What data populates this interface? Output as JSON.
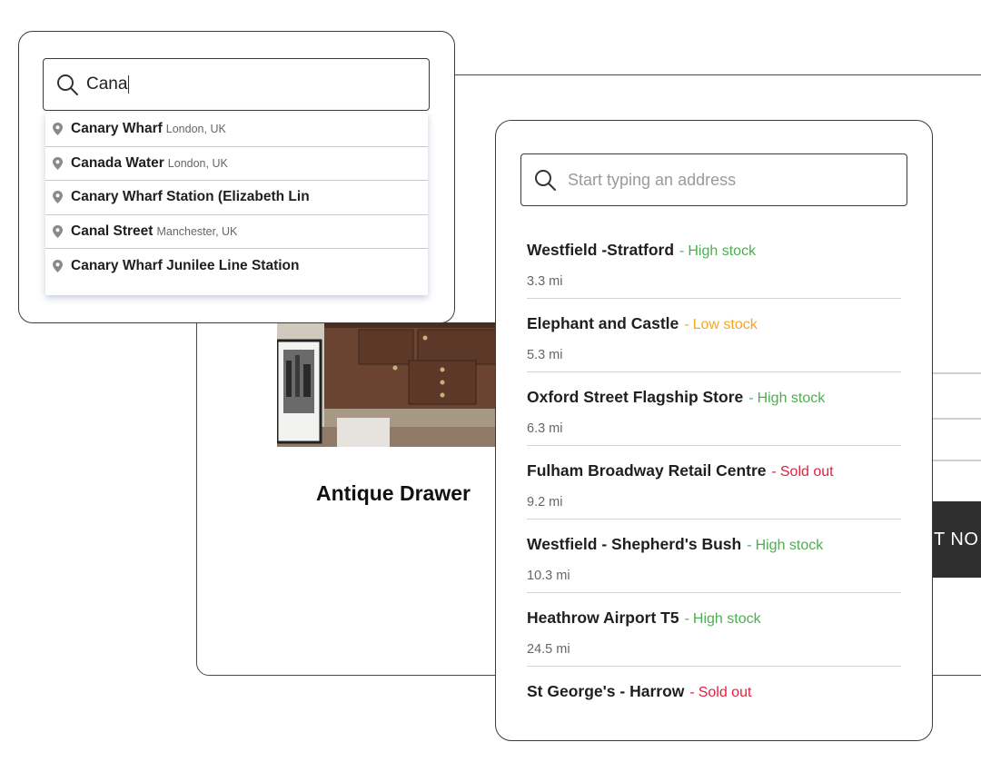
{
  "product": {
    "title": "Antique Drawer",
    "cta_label": "T NO"
  },
  "autocomplete": {
    "query": "Cana",
    "suggestions": [
      {
        "name": "Canary Wharf",
        "detail": "London, UK"
      },
      {
        "name": "Canada Water",
        "detail": "London, UK"
      },
      {
        "name": "Canary Wharf Station (Elizabeth Lin",
        "detail": ""
      },
      {
        "name": "Canal Street",
        "detail": "Manchester, UK"
      },
      {
        "name": "Canary Wharf Junilee Line Station",
        "detail": ""
      }
    ]
  },
  "store_finder": {
    "placeholder": "Start typing an address",
    "separator": "-",
    "stores": [
      {
        "name": "Westfield -Stratford",
        "stock": "High stock",
        "level": "high",
        "distance": "3.3 mi"
      },
      {
        "name": "Elephant and Castle",
        "stock": "Low stock",
        "level": "low",
        "distance": "5.3 mi"
      },
      {
        "name": "Oxford Street Flagship Store",
        "stock": "High stock",
        "level": "high",
        "distance": "6.3 mi"
      },
      {
        "name": "Fulham Broadway Retail Centre",
        "stock": "Sold out",
        "level": "out",
        "distance": "9.2 mi"
      },
      {
        "name": "Westfield - Shepherd's Bush",
        "stock": "High stock",
        "level": "high",
        "distance": "10.3 mi"
      },
      {
        "name": "Heathrow Airport T5",
        "stock": "High stock",
        "level": "high",
        "distance": "24.5 mi"
      },
      {
        "name": "St George's - Harrow",
        "stock": "Sold out",
        "level": "out",
        "distance": ""
      }
    ]
  },
  "colors": {
    "high_stock": "#4caf50",
    "low_stock": "#f5a623",
    "sold_out": "#e0213d",
    "button_bg": "#2f2f2f"
  }
}
